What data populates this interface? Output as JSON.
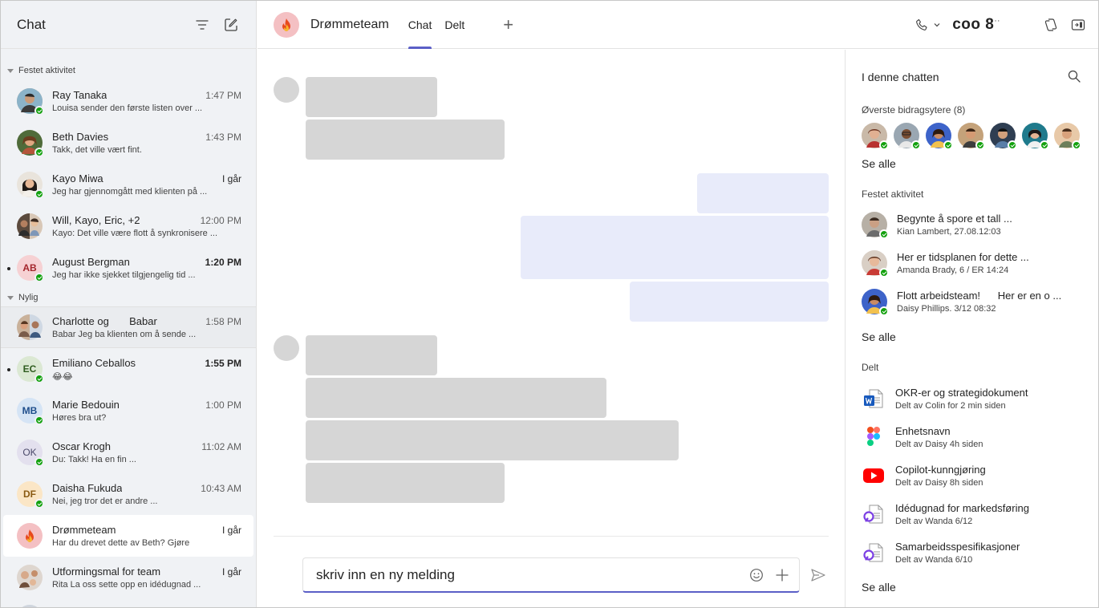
{
  "sidebar": {
    "title": "Chat",
    "filter_icon": "filter-icon",
    "compose_icon": "new-chat-icon",
    "pinned_label": "Festet aktivitet",
    "recent_label": "Nylig",
    "pinned": [
      {
        "name": "Ray Tanaka",
        "time": "1:47 PM",
        "preview": "Louisa sender den første listen over ...",
        "unread": false
      },
      {
        "name": "Beth  Davies",
        "time": "1:43 PM",
        "preview": "Takk, det ville vært fint.",
        "unread": false
      },
      {
        "name": "Kayo Miwa",
        "time": "I går",
        "preview": "Jeg har gjennomgått med klienten på ...",
        "unread": false
      },
      {
        "name": "Will, Kayo, Eric, +2",
        "time": "12:00 PM",
        "preview": "Kayo: Det ville være flott å synkronisere ...",
        "unread": false
      },
      {
        "name": "August Bergman",
        "initials": "AB",
        "time": "1:20 PM",
        "preview": "Jeg har ikke sjekket tilgjengelig tid ...",
        "unread": true
      }
    ],
    "recent": [
      {
        "name": "Charlotte og       Babar",
        "time": "1:58 PM",
        "preview": "Babar Jeg ba klienten om å sende ...",
        "unread": false
      },
      {
        "name": "Emiliano Ceballos",
        "initials": "EC",
        "time": "1:55 PM",
        "preview": "😂😂",
        "unread": true
      },
      {
        "name": "Marie Bedouin",
        "initials": "MB",
        "time": "1:00 PM",
        "preview": "Høres bra ut?",
        "unread": false
      },
      {
        "name": "Oscar Krogh",
        "initials": "OK",
        "time": "11:02 AM",
        "preview": "Du: Takk! Ha en fin ...",
        "unread": false
      },
      {
        "name": "Daisha Fukuda",
        "initials": "DF",
        "time": "10:43 AM",
        "preview": "Nei, jeg tror det er andre ...",
        "unread": false
      },
      {
        "name": "Drømmeteam",
        "time": "I går",
        "preview": "Har du drevet dette av Beth? Gjøre",
        "unread": false
      },
      {
        "name": "Utformingsmal for team",
        "time": "I går",
        "preview": "Rita La oss sette opp en idédugnad ...",
        "unread": false
      }
    ]
  },
  "header": {
    "group_name": "Drømmeteam",
    "tabs": [
      "Chat",
      "Delt"
    ],
    "add_tab": "+",
    "people_count": "coo 8",
    "people_suffix": "··"
  },
  "compose": {
    "text": "skriv inn en ny melding"
  },
  "right_panel": {
    "title": "I denne chatten",
    "contributors_label": "Øverste bidragsytere (8)",
    "see_all_1": "Se alle",
    "pinned_label": "Festet aktivitet",
    "pinned": [
      {
        "title": "Begynte å spore et tall ...",
        "sub": "Kian Lambert, 27.08.12:03"
      },
      {
        "title": "Her er tidsplanen for dette ...",
        "sub": "Amanda Brady, 6 / ER 14:24"
      },
      {
        "title": "Flott arbeidsteam!      Her er en o ...",
        "sub": "Daisy Phillips. 3/12 08:32"
      }
    ],
    "see_all_2": "Se alle",
    "shared_label": "Delt",
    "files": [
      {
        "title": "OKR-er og strategidokument",
        "sub": "Delt av Colin for 2 min siden",
        "icon": "word-icon"
      },
      {
        "title": "Enhetsnavn",
        "sub": "Delt av Daisy 4h siden",
        "icon": "figma-icon"
      },
      {
        "title": "Copilot-kunngjøring",
        "sub": "Delt av Daisy 8h siden",
        "icon": "youtube-icon"
      },
      {
        "title": "Idédugnad for markedsføring",
        "sub": "Delt av Wanda 6/12",
        "icon": "loop-icon"
      },
      {
        "title": "Samarbeidsspesifikasjoner",
        "sub": "Delt av Wanda 6/10",
        "icon": "loop-icon"
      }
    ],
    "see_all_3": "Se alle"
  },
  "colors": {
    "accent": "#5b5fc7",
    "presence": "#13a10e",
    "my_bubble": "#e8ebfa",
    "placeholder": "#d6d6d6"
  }
}
